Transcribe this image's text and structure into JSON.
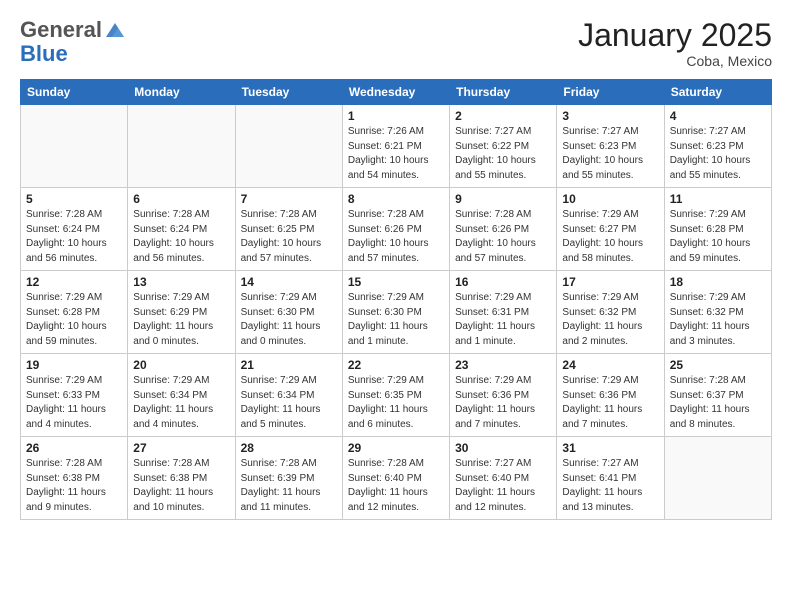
{
  "header": {
    "logo_general": "General",
    "logo_blue": "Blue",
    "month_title": "January 2025",
    "location": "Coba, Mexico"
  },
  "days_of_week": [
    "Sunday",
    "Monday",
    "Tuesday",
    "Wednesday",
    "Thursday",
    "Friday",
    "Saturday"
  ],
  "weeks": [
    [
      {
        "num": "",
        "info": ""
      },
      {
        "num": "",
        "info": ""
      },
      {
        "num": "",
        "info": ""
      },
      {
        "num": "1",
        "info": "Sunrise: 7:26 AM\nSunset: 6:21 PM\nDaylight: 10 hours\nand 54 minutes."
      },
      {
        "num": "2",
        "info": "Sunrise: 7:27 AM\nSunset: 6:22 PM\nDaylight: 10 hours\nand 55 minutes."
      },
      {
        "num": "3",
        "info": "Sunrise: 7:27 AM\nSunset: 6:23 PM\nDaylight: 10 hours\nand 55 minutes."
      },
      {
        "num": "4",
        "info": "Sunrise: 7:27 AM\nSunset: 6:23 PM\nDaylight: 10 hours\nand 55 minutes."
      }
    ],
    [
      {
        "num": "5",
        "info": "Sunrise: 7:28 AM\nSunset: 6:24 PM\nDaylight: 10 hours\nand 56 minutes."
      },
      {
        "num": "6",
        "info": "Sunrise: 7:28 AM\nSunset: 6:24 PM\nDaylight: 10 hours\nand 56 minutes."
      },
      {
        "num": "7",
        "info": "Sunrise: 7:28 AM\nSunset: 6:25 PM\nDaylight: 10 hours\nand 57 minutes."
      },
      {
        "num": "8",
        "info": "Sunrise: 7:28 AM\nSunset: 6:26 PM\nDaylight: 10 hours\nand 57 minutes."
      },
      {
        "num": "9",
        "info": "Sunrise: 7:28 AM\nSunset: 6:26 PM\nDaylight: 10 hours\nand 57 minutes."
      },
      {
        "num": "10",
        "info": "Sunrise: 7:29 AM\nSunset: 6:27 PM\nDaylight: 10 hours\nand 58 minutes."
      },
      {
        "num": "11",
        "info": "Sunrise: 7:29 AM\nSunset: 6:28 PM\nDaylight: 10 hours\nand 59 minutes."
      }
    ],
    [
      {
        "num": "12",
        "info": "Sunrise: 7:29 AM\nSunset: 6:28 PM\nDaylight: 10 hours\nand 59 minutes."
      },
      {
        "num": "13",
        "info": "Sunrise: 7:29 AM\nSunset: 6:29 PM\nDaylight: 11 hours\nand 0 minutes."
      },
      {
        "num": "14",
        "info": "Sunrise: 7:29 AM\nSunset: 6:30 PM\nDaylight: 11 hours\nand 0 minutes."
      },
      {
        "num": "15",
        "info": "Sunrise: 7:29 AM\nSunset: 6:30 PM\nDaylight: 11 hours\nand 1 minute."
      },
      {
        "num": "16",
        "info": "Sunrise: 7:29 AM\nSunset: 6:31 PM\nDaylight: 11 hours\nand 1 minute."
      },
      {
        "num": "17",
        "info": "Sunrise: 7:29 AM\nSunset: 6:32 PM\nDaylight: 11 hours\nand 2 minutes."
      },
      {
        "num": "18",
        "info": "Sunrise: 7:29 AM\nSunset: 6:32 PM\nDaylight: 11 hours\nand 3 minutes."
      }
    ],
    [
      {
        "num": "19",
        "info": "Sunrise: 7:29 AM\nSunset: 6:33 PM\nDaylight: 11 hours\nand 4 minutes."
      },
      {
        "num": "20",
        "info": "Sunrise: 7:29 AM\nSunset: 6:34 PM\nDaylight: 11 hours\nand 4 minutes."
      },
      {
        "num": "21",
        "info": "Sunrise: 7:29 AM\nSunset: 6:34 PM\nDaylight: 11 hours\nand 5 minutes."
      },
      {
        "num": "22",
        "info": "Sunrise: 7:29 AM\nSunset: 6:35 PM\nDaylight: 11 hours\nand 6 minutes."
      },
      {
        "num": "23",
        "info": "Sunrise: 7:29 AM\nSunset: 6:36 PM\nDaylight: 11 hours\nand 7 minutes."
      },
      {
        "num": "24",
        "info": "Sunrise: 7:29 AM\nSunset: 6:36 PM\nDaylight: 11 hours\nand 7 minutes."
      },
      {
        "num": "25",
        "info": "Sunrise: 7:28 AM\nSunset: 6:37 PM\nDaylight: 11 hours\nand 8 minutes."
      }
    ],
    [
      {
        "num": "26",
        "info": "Sunrise: 7:28 AM\nSunset: 6:38 PM\nDaylight: 11 hours\nand 9 minutes."
      },
      {
        "num": "27",
        "info": "Sunrise: 7:28 AM\nSunset: 6:38 PM\nDaylight: 11 hours\nand 10 minutes."
      },
      {
        "num": "28",
        "info": "Sunrise: 7:28 AM\nSunset: 6:39 PM\nDaylight: 11 hours\nand 11 minutes."
      },
      {
        "num": "29",
        "info": "Sunrise: 7:28 AM\nSunset: 6:40 PM\nDaylight: 11 hours\nand 12 minutes."
      },
      {
        "num": "30",
        "info": "Sunrise: 7:27 AM\nSunset: 6:40 PM\nDaylight: 11 hours\nand 12 minutes."
      },
      {
        "num": "31",
        "info": "Sunrise: 7:27 AM\nSunset: 6:41 PM\nDaylight: 11 hours\nand 13 minutes."
      },
      {
        "num": "",
        "info": ""
      }
    ]
  ]
}
